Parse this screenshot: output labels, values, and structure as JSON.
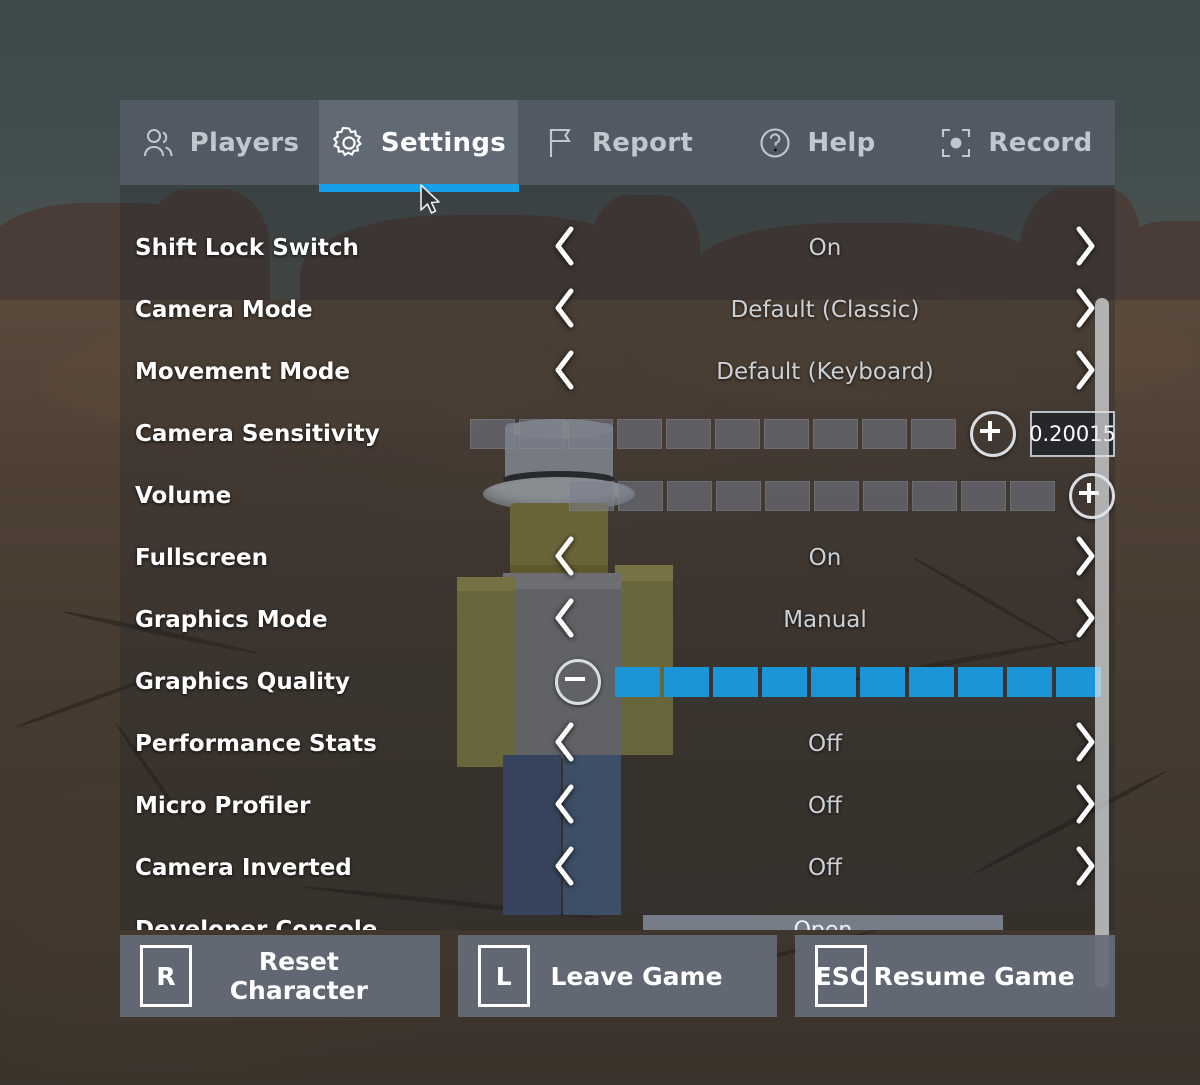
{
  "tabs": [
    {
      "label": "Players",
      "icon": "people-icon",
      "active": false
    },
    {
      "label": "Settings",
      "icon": "gear-icon",
      "active": true
    },
    {
      "label": "Report",
      "icon": "flag-icon",
      "active": false
    },
    {
      "label": "Help",
      "icon": "question-circle-icon",
      "active": false
    },
    {
      "label": "Record",
      "icon": "record-frame-icon",
      "active": false
    }
  ],
  "settings": [
    {
      "label": "Shift Lock Switch",
      "type": "select",
      "value": "On"
    },
    {
      "label": "Camera Mode",
      "type": "select",
      "value": "Default (Classic)"
    },
    {
      "label": "Movement Mode",
      "type": "select",
      "value": "Default (Keyboard)"
    },
    {
      "label": "Camera Sensitivity",
      "type": "slider",
      "segments": 10,
      "filled": 0,
      "button": "plus",
      "value_box": "0.20015"
    },
    {
      "label": "Volume",
      "type": "slider",
      "segments": 10,
      "filled": 0,
      "button": "plus"
    },
    {
      "label": "Fullscreen",
      "type": "select",
      "value": "On"
    },
    {
      "label": "Graphics Mode",
      "type": "select",
      "value": "Manual"
    },
    {
      "label": "Graphics Quality",
      "type": "slider",
      "segments": 10,
      "filled": 10,
      "button": "minus"
    },
    {
      "label": "Performance Stats",
      "type": "select",
      "value": "Off"
    },
    {
      "label": "Micro Profiler",
      "type": "select",
      "value": "Off"
    },
    {
      "label": "Camera Inverted",
      "type": "select",
      "value": "Off"
    },
    {
      "label": "Developer Console",
      "type": "button",
      "value": "Open"
    }
  ],
  "actions": [
    {
      "key": "R",
      "label": "Reset Character"
    },
    {
      "key": "L",
      "label": "Leave Game"
    },
    {
      "key": "ESC",
      "label": "Resume Game"
    }
  ],
  "colors": {
    "accent": "#15a0e8",
    "slider_fill": "#1c94d8",
    "panel": "#555c67",
    "text": "#ffffff",
    "value_text": "#cdd1d6"
  }
}
